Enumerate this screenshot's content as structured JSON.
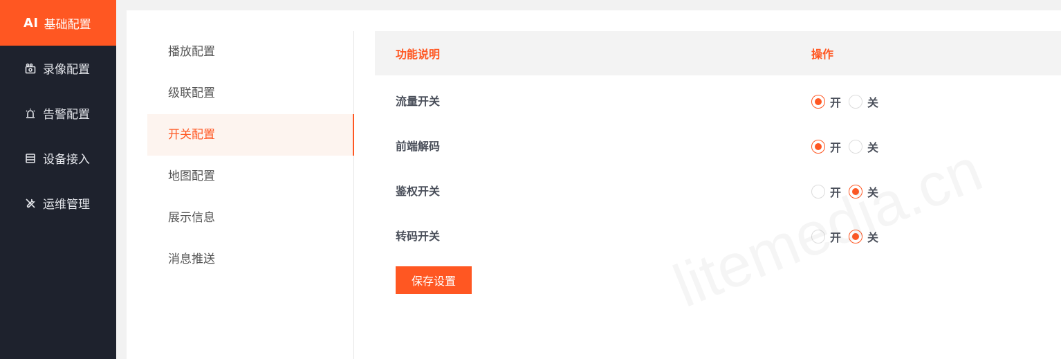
{
  "sidebar": {
    "items": [
      {
        "prefix": "AI",
        "label": "基础配置",
        "icon": "ai-text-icon",
        "active": true
      },
      {
        "label": "录像配置",
        "icon": "camera-icon"
      },
      {
        "label": "告警配置",
        "icon": "alarm-icon"
      },
      {
        "label": "设备接入",
        "icon": "server-icon"
      },
      {
        "label": "运维管理",
        "icon": "tools-icon"
      }
    ]
  },
  "subnav": {
    "items": [
      "播放配置",
      "级联配置",
      "开关配置",
      "地图配置",
      "展示信息",
      "消息推送"
    ],
    "active_index": 2
  },
  "table": {
    "headers": [
      "功能说明",
      "操作"
    ],
    "rows": [
      {
        "label": "流量开关",
        "on_label": "开",
        "off_label": "关",
        "value": "on"
      },
      {
        "label": "前端解码",
        "on_label": "开",
        "off_label": "关",
        "value": "on"
      },
      {
        "label": "鉴权开关",
        "on_label": "开",
        "off_label": "关",
        "value": "off"
      },
      {
        "label": "转码开关",
        "on_label": "开",
        "off_label": "关",
        "value": "off"
      }
    ]
  },
  "save_label": "保存设置",
  "watermark": "litemedia.cn",
  "colors": {
    "accent": "#ff5722",
    "sidebar_bg": "#1e222d"
  }
}
